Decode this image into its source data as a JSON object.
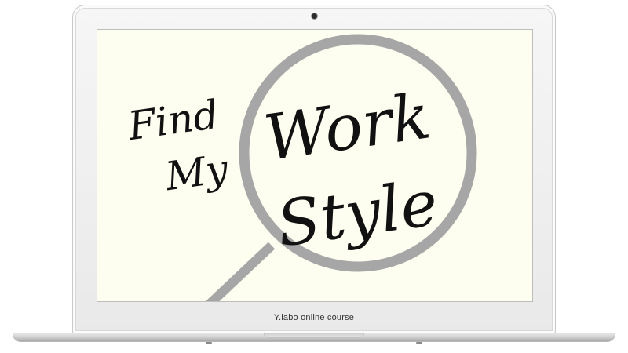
{
  "device": {
    "type": "laptop",
    "bezel_color": "#eeeeee",
    "screen_background": "#fdfdf0"
  },
  "screen": {
    "headline_left": [
      "Find",
      "My"
    ],
    "headline_lens": [
      "Work",
      "Style"
    ],
    "lens_color": "#a6a6a6",
    "text_color": "#111111",
    "icon": "magnifying-glass"
  },
  "footer": {
    "label": "Y.labo online course"
  }
}
